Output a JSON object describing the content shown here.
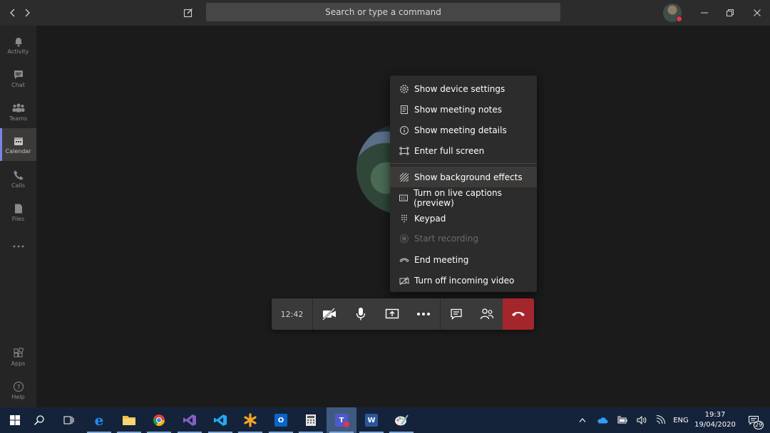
{
  "titlebar": {
    "search_placeholder": "Search or type a command"
  },
  "rail": {
    "items": [
      {
        "label": "Activity",
        "icon": "bell-icon"
      },
      {
        "label": "Chat",
        "icon": "chat-icon"
      },
      {
        "label": "Teams",
        "icon": "teams-icon"
      },
      {
        "label": "Calendar",
        "icon": "calendar-icon"
      },
      {
        "label": "Calls",
        "icon": "phone-icon"
      },
      {
        "label": "Files",
        "icon": "file-icon"
      },
      {
        "label": "Apps",
        "icon": "apps-icon"
      },
      {
        "label": "Help",
        "icon": "help-icon"
      }
    ],
    "active": "Calendar"
  },
  "menu": {
    "items": [
      {
        "label": "Show device settings",
        "icon": "gear-icon"
      },
      {
        "label": "Show meeting notes",
        "icon": "notes-icon"
      },
      {
        "label": "Show meeting details",
        "icon": "info-icon"
      },
      {
        "label": "Enter full screen",
        "icon": "fullscreen-icon"
      },
      {
        "label": "Show background effects",
        "icon": "background-effects-icon"
      },
      {
        "label": "Turn on live captions (preview)",
        "icon": "captions-icon"
      },
      {
        "label": "Keypad",
        "icon": "keypad-icon"
      },
      {
        "label": "Start recording",
        "icon": "record-icon",
        "disabled": true
      },
      {
        "label": "End meeting",
        "icon": "end-meeting-icon"
      },
      {
        "label": "Turn off incoming video",
        "icon": "video-off-icon"
      }
    ],
    "highlighted": "Show background effects"
  },
  "controls": {
    "timer": "12:42"
  },
  "taskbar": {
    "language": "ENG",
    "time": "19:37",
    "date": "19/04/2020",
    "notification_count": "29"
  },
  "colors": {
    "accent": "#7b83eb",
    "hangup": "#a4262c",
    "presence_busy": "#e0364c",
    "taskbar": "#15233a"
  }
}
